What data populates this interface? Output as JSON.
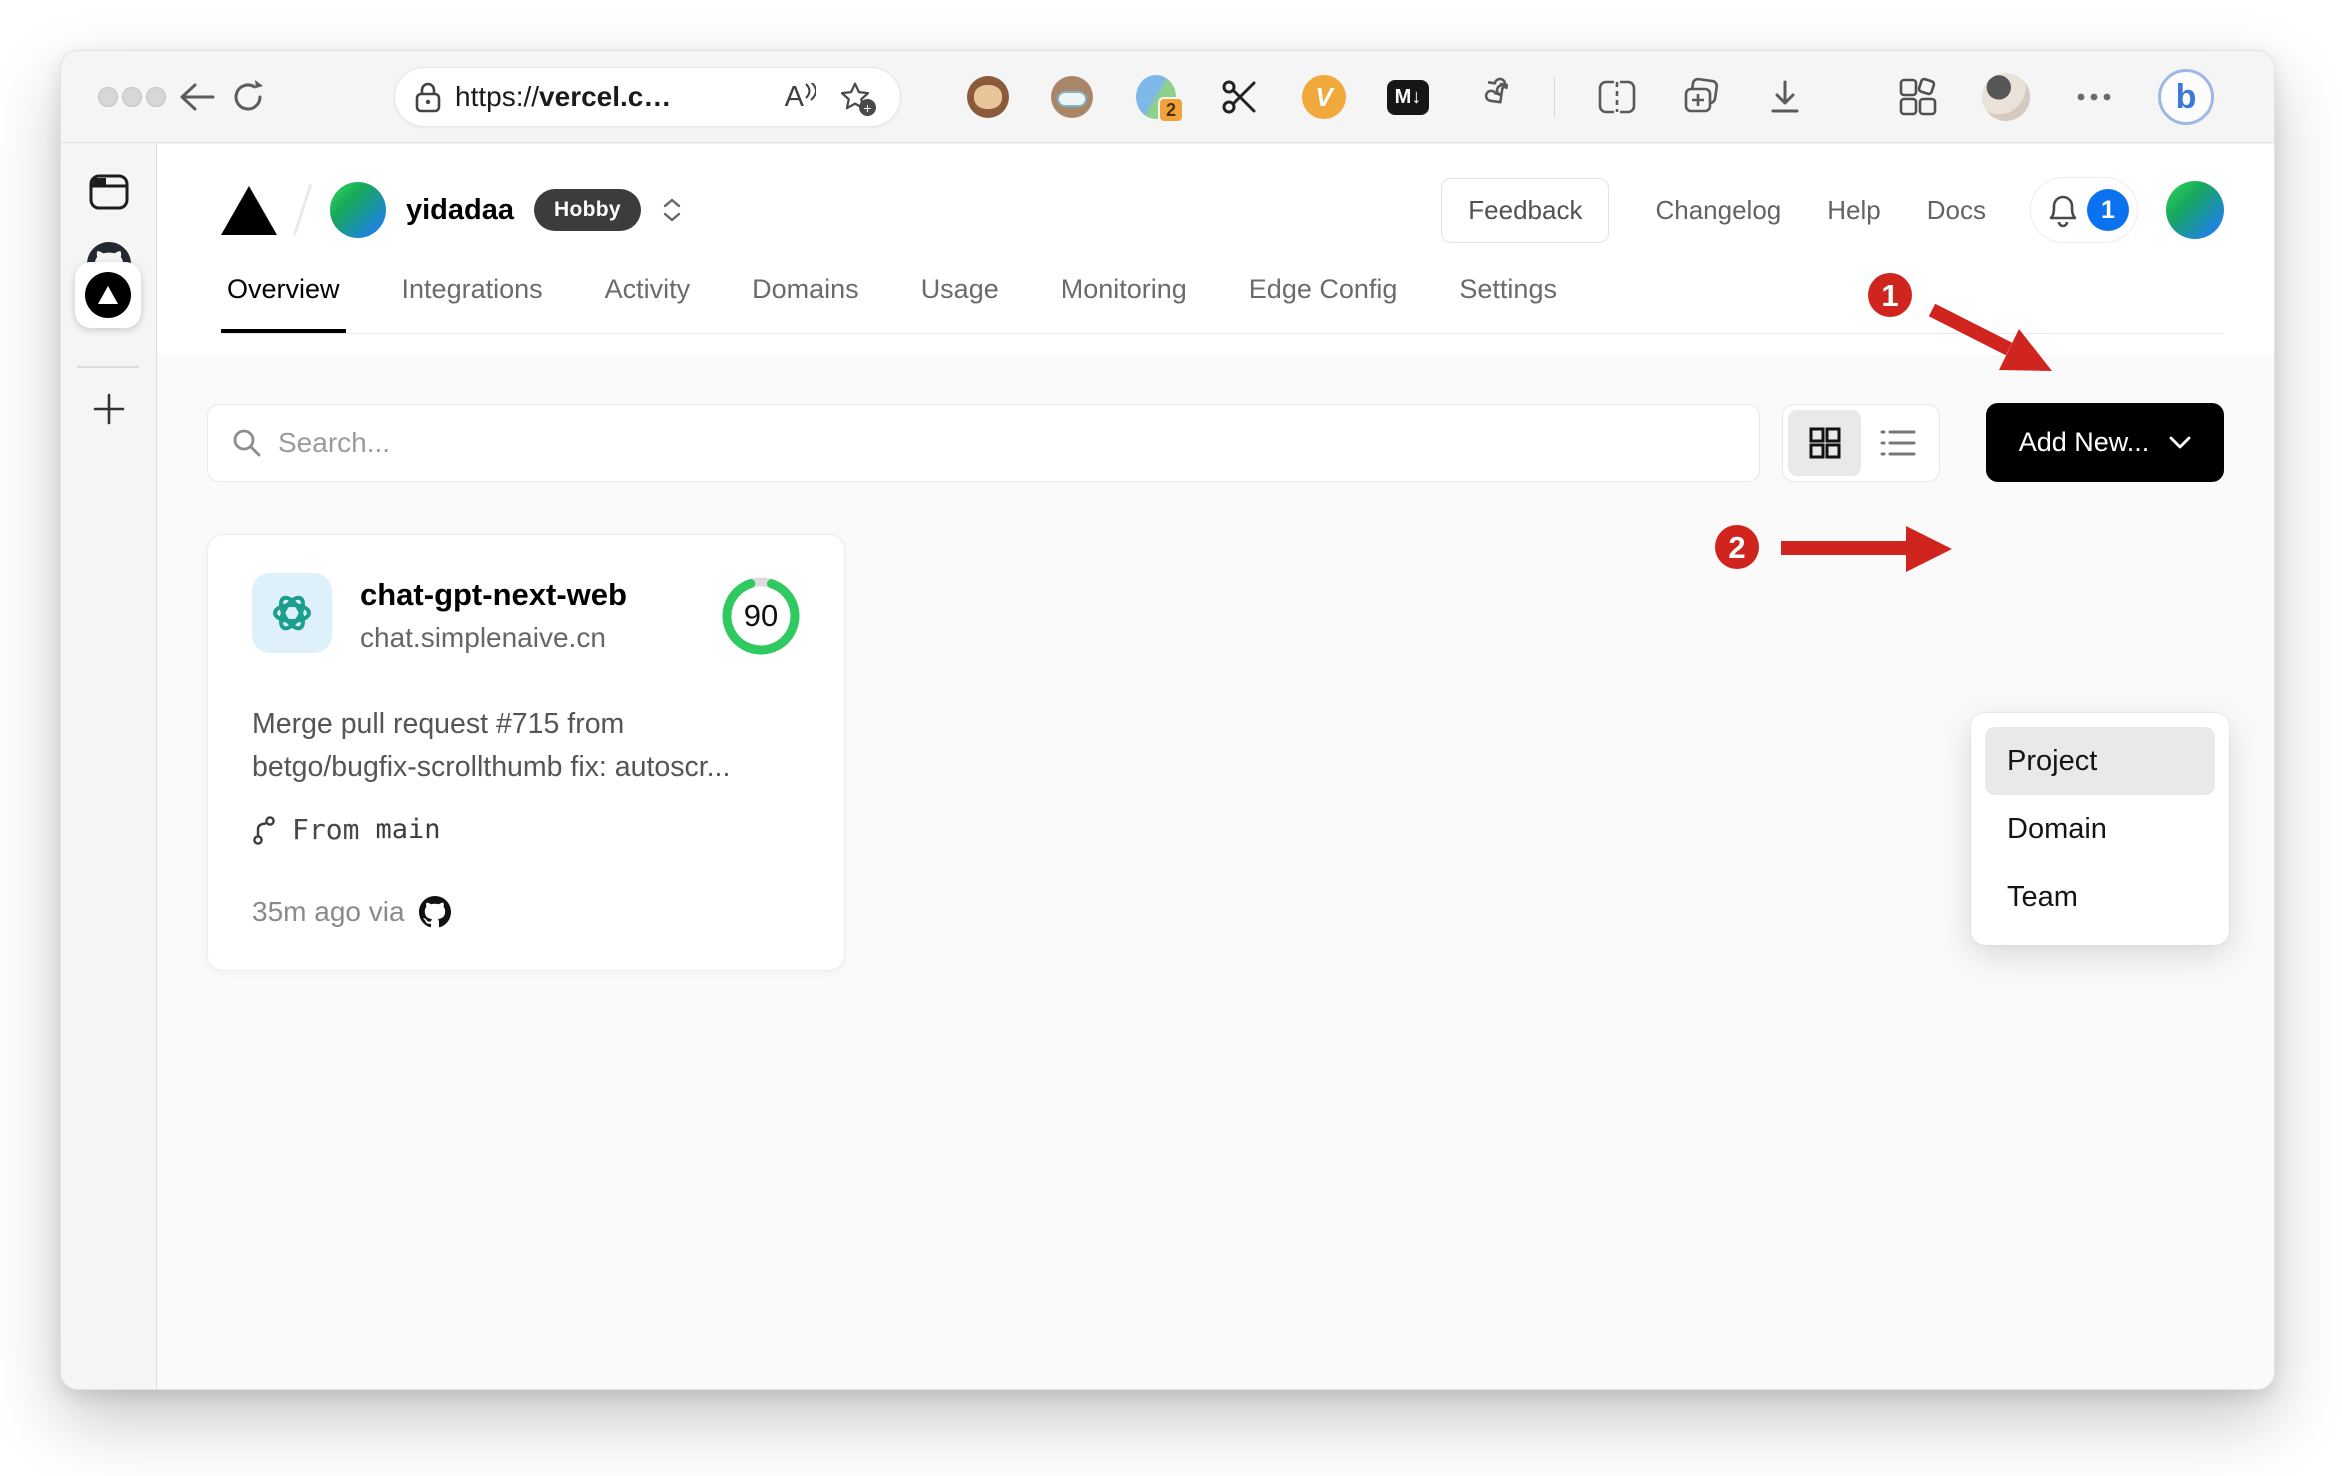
{
  "colors": {
    "annotation_red": "#d0251e",
    "score_green": "#2fca5f",
    "notification_blue": "#0b72ef",
    "openai_teal": "#1b9e8d"
  },
  "browser": {
    "url": {
      "prefix": "https://",
      "host": "vercel.c",
      "ellipsis": "…"
    },
    "extensions": {
      "translate_badge": "2",
      "v_label": "V",
      "markdown_label": "M↓"
    },
    "bing_label": "b"
  },
  "vercel": {
    "header": {
      "team": "yidadaa",
      "plan_badge": "Hobby",
      "feedback": "Feedback",
      "changelog": "Changelog",
      "help": "Help",
      "docs": "Docs",
      "notification_count": "1"
    },
    "tabs": [
      {
        "label": "Overview",
        "active": true
      },
      {
        "label": "Integrations"
      },
      {
        "label": "Activity"
      },
      {
        "label": "Domains"
      },
      {
        "label": "Usage"
      },
      {
        "label": "Monitoring"
      },
      {
        "label": "Edge Config"
      },
      {
        "label": "Settings"
      }
    ],
    "controls": {
      "search_placeholder": "Search...",
      "add_new_label": "Add New..."
    },
    "dropdown": {
      "items": [
        {
          "label": "Project",
          "highlighted": true
        },
        {
          "label": "Domain"
        },
        {
          "label": "Team"
        }
      ]
    },
    "card": {
      "name": "chat-gpt-next-web",
      "domain": "chat.simplenaive.cn",
      "score": "90",
      "commit_line1": "Merge pull request #715 from",
      "commit_line2": "betgo/bugfix-scrollthumb fix: autoscr...",
      "branch_label": "From",
      "branch": "main",
      "meta": "35m ago via"
    }
  },
  "annotations": {
    "step1": "1",
    "step2": "2"
  }
}
